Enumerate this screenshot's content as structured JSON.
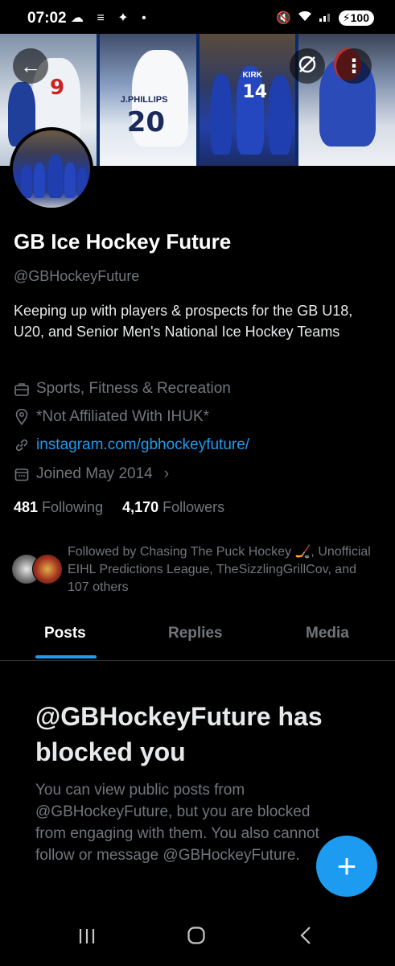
{
  "status_bar": {
    "time": "07:02",
    "left_icons": "☁ ≡ ✦ •",
    "battery": "100"
  },
  "profile": {
    "name": "GB Ice Hockey Future",
    "handle": "@GBHockeyFuture",
    "bio": "Keeping up with players & prospects for the GB U18, U20, and Senior Men's National Ice Hockey Teams",
    "category": "Sports, Fitness & Recreation",
    "location": "*Not Affiliated With IHUK*",
    "website": "instagram.com/gbhockeyfuture/",
    "joined": "Joined May 2014",
    "following_count": "481",
    "following_label": "Following",
    "followers_count": "4,170",
    "followers_label": "Followers",
    "followed_by": "Followed by Chasing The Puck Hockey 🏒, Unofficial EIHL Predictions League, TheSizzlingGrillCov, and 107 others"
  },
  "banner": {
    "jersey_numbers": [
      "9",
      "20",
      "14"
    ],
    "name_bars": [
      "J.PHILLIPS",
      "KIRK"
    ]
  },
  "tabs": [
    {
      "label": "Posts",
      "active": true
    },
    {
      "label": "Replies",
      "active": false
    },
    {
      "label": "Media",
      "active": false
    }
  ],
  "blocked": {
    "title": "@GBHockeyFuture has blocked you",
    "description": "You can view public posts from @GBHockeyFuture, but you are blocked from engaging with them. You also cannot follow or message @GBHockeyFuture."
  },
  "fab": {
    "label": "+"
  },
  "colors": {
    "accent": "#1d9bf0",
    "background": "#000000",
    "muted_text": "#71767b"
  },
  "icons": [
    "back-arrow-icon",
    "grok-icon",
    "more-icon",
    "briefcase-icon",
    "location-icon",
    "link-icon",
    "calendar-icon",
    "chevron-right-icon",
    "plus-icon"
  ]
}
